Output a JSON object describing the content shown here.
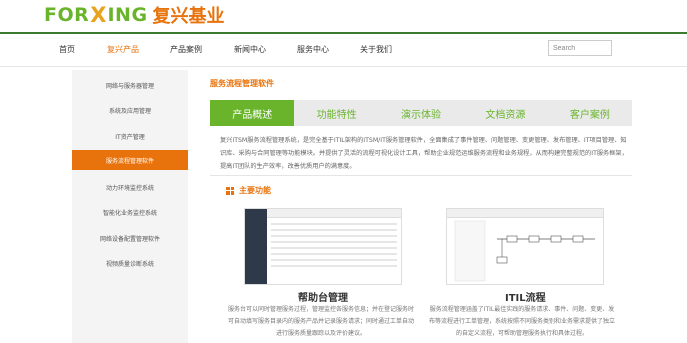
{
  "logo": {
    "left": "FOR",
    "mark": "X",
    "right": "ING",
    "cn": "复兴基业"
  },
  "nav": {
    "items": [
      "首页",
      "复兴产品",
      "产品案例",
      "新闻中心",
      "服务中心",
      "关于我们"
    ],
    "active_index": 1,
    "search_placeholder": "Search"
  },
  "sidebar": {
    "items": [
      "网络与服务器管理",
      "系统及应用管理",
      "IT资产管理",
      "服务流程管理软件",
      "动力环境监控系统",
      "智能化业务监控系统",
      "网络设备配置管理软件",
      "视频质量诊断系统"
    ],
    "active_index": 3
  },
  "main": {
    "title": "服务流程管理软件",
    "tabs": [
      "产品概述",
      "功能特性",
      "演示体验",
      "文档资源",
      "客户案例"
    ],
    "active_tab": 0,
    "intro": "复兴ITSM服务流程管理系统，是完全基于ITIL架构的ITSM/IT服务管理软件，全面集成了事件管理、问题管理、变更管理、发布管理、IT项目管理、知识库、采购与合同管理等功能模块。并提供了灵活的流程可视化设计工具，帮助企业规范运维服务流程和业务规程，从而构建完整规范的IT服务框架，提高IT团队的生产效率，改善优质用户的满意度。",
    "feature_heading": "主要功能",
    "features": [
      {
        "caption": "帮助台管理",
        "desc": "服务台可以同时管理服务过程，管理监控各服务信息；并在登记服务时可自动填写服务目录内的服务产品并记录服务请求；同时通过工单自动进行服务质量跟踪以及评价建议。"
      },
      {
        "caption": "ITIL流程",
        "desc": "服务流程管理涵盖了ITIL最佳实践的服务请求、事件、问题、变更、发布等流程进行工单管理，系统按照不同服务类别和业务需求提供了独立的自定义流程，可帮助管理服务执行和具体过程。"
      }
    ]
  },
  "colors": {
    "green": "#6ab42c",
    "orange": "#e8730c",
    "dark_green": "#3a7b2d"
  }
}
